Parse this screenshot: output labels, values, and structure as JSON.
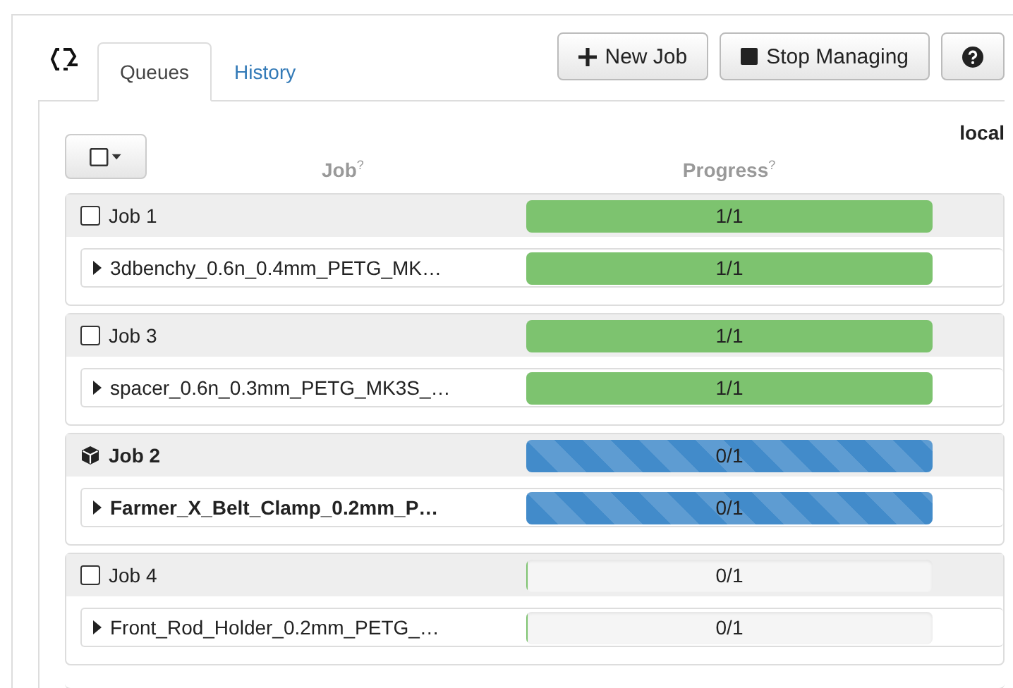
{
  "tabs": [
    {
      "label": "Queues",
      "selected": true
    },
    {
      "label": "History",
      "selected": false
    }
  ],
  "buttons": [
    {
      "kind": "new",
      "label": "New Job"
    },
    {
      "kind": "stop",
      "label": "Stop Managing"
    },
    {
      "kind": "help"
    }
  ],
  "queue_label": "local",
  "columns": [
    {
      "label": "Job",
      "hint": "?"
    },
    {
      "label": "Progress",
      "hint": "?"
    }
  ],
  "jobs": [
    {
      "name": "Job 1",
      "active": false,
      "level": 1,
      "progress": "1/1",
      "files": [
        {
          "name": "3dbenchy_0.6n_0.4mm_PETG_MK…",
          "expanded": false,
          "active": false,
          "level": 1,
          "progress": "1/1"
        }
      ]
    },
    {
      "name": "Job 3",
      "active": false,
      "level": 1,
      "progress": "1/1",
      "files": [
        {
          "name": "spacer_0.6n_0.3mm_PETG_MK3S_…",
          "expanded": false,
          "active": false,
          "level": 1,
          "progress": "1/1"
        }
      ]
    },
    {
      "name": "Job 2",
      "active": true,
      "level": 1,
      "progress": "0/1",
      "files": [
        {
          "name": "Farmer_X_Belt_Clamp_0.2mm_P…",
          "expanded": false,
          "active": true,
          "level": 1,
          "progress": "0/1"
        }
      ]
    },
    {
      "name": "Job 4",
      "active": false,
      "level": 0,
      "progress": "0/1",
      "files": [
        {
          "name": "Front_Rod_Holder_0.2mm_PETG_…",
          "expanded": false,
          "active": false,
          "level": 0,
          "progress": "0/1"
        }
      ]
    }
  ]
}
